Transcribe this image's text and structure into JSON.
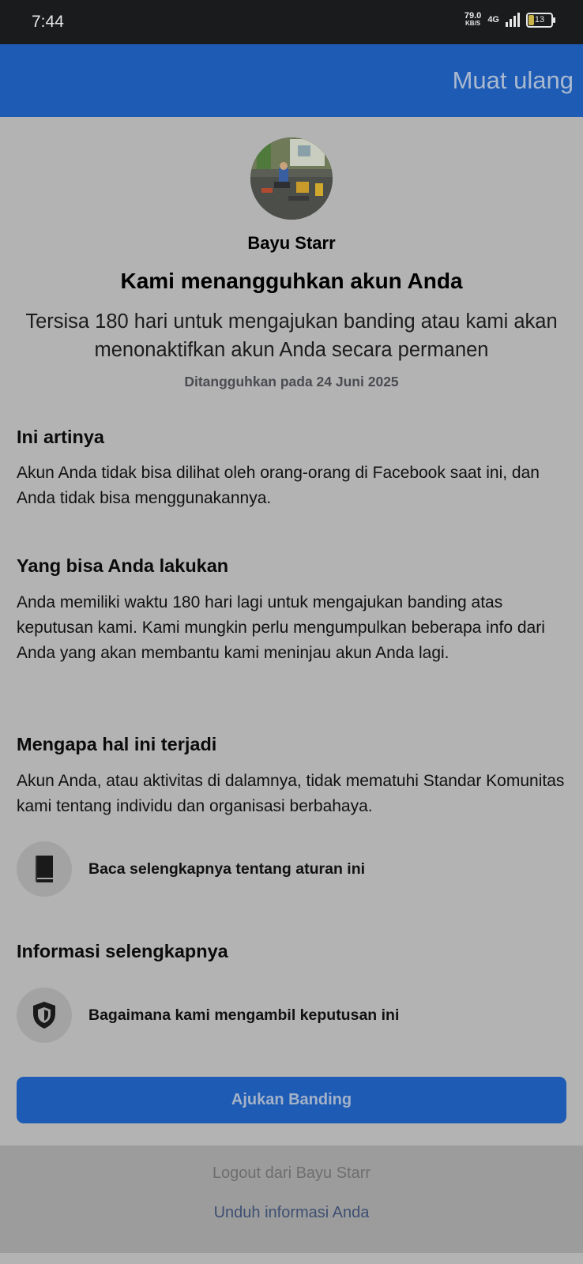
{
  "status_bar": {
    "time": "7:44",
    "net_speed": "79.0",
    "net_unit": "KB/S",
    "network": "4G",
    "battery": "13"
  },
  "header": {
    "reload_label": "Muat ulang"
  },
  "profile": {
    "name": "Bayu Starr"
  },
  "notice": {
    "title": "Kami menangguhkan akun Anda",
    "subtitle": "Tersisa 180 hari untuk mengajukan banding atau kami akan menonaktifkan akun Anda secara permanen",
    "date": "Ditangguhkan pada 24 Juni 2025"
  },
  "sections": {
    "meaning": {
      "heading": "Ini artinya",
      "body": "Akun Anda tidak bisa dilihat oleh orang-orang di Facebook saat ini, dan Anda tidak bisa menggunakannya."
    },
    "can_do": {
      "heading": "Yang bisa Anda lakukan",
      "body": "Anda memiliki waktu 180 hari lagi untuk mengajukan banding atas keputusan kami. Kami mungkin perlu mengumpulkan beberapa info dari Anda yang akan membantu kami meninjau akun Anda lagi."
    },
    "why": {
      "heading": "Mengapa hal ini terjadi",
      "body": "Akun Anda, atau aktivitas di dalamnya, tidak mematuhi Standar Komunitas kami tentang individu dan organisasi berbahaya.",
      "link_label": "Baca selengkapnya tentang aturan ini",
      "link_icon": "book-icon"
    },
    "more_info": {
      "heading": "Informasi selengkapnya",
      "link_label": "Bagaimana kami mengambil keputusan ini",
      "link_icon": "shield-icon"
    }
  },
  "appeal_button": "Ajukan Banding",
  "footer": {
    "logout_label": "Logout dari Bayu Starr",
    "download_label": "Unduh informasi Anda"
  },
  "colors": {
    "brand_blue": "#1e5bb5",
    "page_bg": "#b3b3b3",
    "status_bar": "#1a1b1d"
  }
}
